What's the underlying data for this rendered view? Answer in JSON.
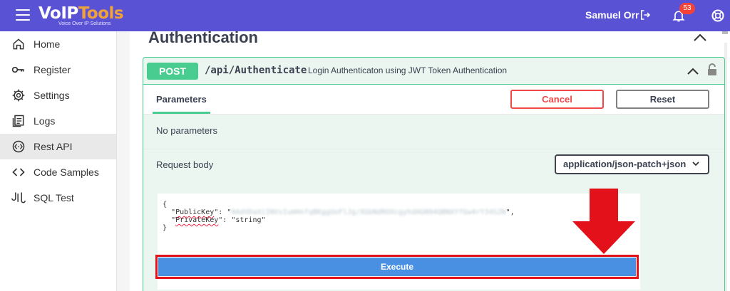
{
  "header": {
    "logo": {
      "part1": "VoIP",
      "part2": "Tools",
      "tagline": "Voice Over IP Solutions"
    },
    "user_name": "Samuel Orr",
    "notification_count": "53"
  },
  "sidebar": {
    "items": [
      {
        "label": "Home",
        "icon": "home-icon"
      },
      {
        "label": "Register",
        "icon": "key-icon"
      },
      {
        "label": "Settings",
        "icon": "gear-icon"
      },
      {
        "label": "Logs",
        "icon": "logs-icon"
      },
      {
        "label": "Rest API",
        "icon": "api-icon",
        "active": true
      },
      {
        "label": "Code Samples",
        "icon": "code-icon"
      },
      {
        "label": "SQL Test",
        "icon": "sql-test-icon"
      }
    ]
  },
  "section": {
    "title": "Authentication"
  },
  "operation": {
    "method": "POST",
    "path": "/api/Authenticate",
    "description": "Login Authenticaton using JWT Token Authentication",
    "tab_label": "Parameters",
    "cancel_label": "Cancel",
    "reset_label": "Reset",
    "no_params": "No parameters",
    "request_body_label": "Request body",
    "content_type": "application/json-patch+json",
    "body": {
      "open": "{",
      "public_key_name": "PublicKey",
      "public_key_value": "0AdVDaXiINVsIumHnfqBKggUoFlJg/XGbNdROXcgyhdAGN94QBNXYfGw4rY34SZN",
      "private_key_name": "PrivateKey",
      "private_key_value": "string",
      "close": "}"
    },
    "execute_label": "Execute"
  },
  "colors": {
    "topbar": "#5a52d5",
    "accent_green": "#49cc90",
    "cancel_red": "#f24747",
    "execute_blue": "#4a90e2",
    "highlight_red": "#e3111a"
  }
}
